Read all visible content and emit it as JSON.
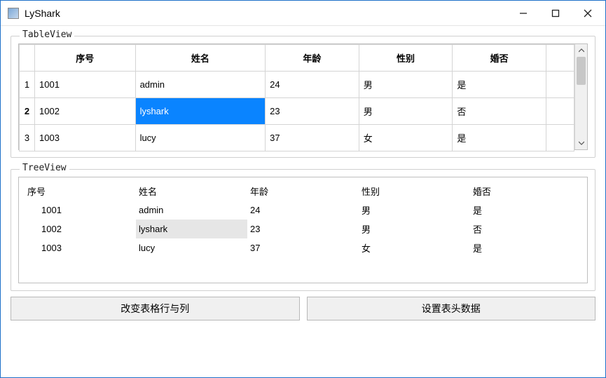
{
  "window": {
    "title": "LyShark"
  },
  "tableview": {
    "label": "TableView",
    "columns": [
      "序号",
      "姓名",
      "年龄",
      "性别",
      "婚否"
    ],
    "rowNumbers": [
      "1",
      "2",
      "3"
    ],
    "rows": [
      [
        "1001",
        "admin",
        "24",
        "男",
        "是"
      ],
      [
        "1002",
        "lyshark",
        "23",
        "男",
        "否"
      ],
      [
        "1003",
        "lucy",
        "37",
        "女",
        "是"
      ]
    ],
    "selected": {
      "row": 1,
      "col": 1
    },
    "boldRowHeader": 1
  },
  "treeview": {
    "label": "TreeView",
    "columns": [
      "序号",
      "姓名",
      "年龄",
      "性别",
      "婚否"
    ],
    "rows": [
      [
        "1001",
        "admin",
        "24",
        "男",
        "是"
      ],
      [
        "1002",
        "lyshark",
        "23",
        "男",
        "否"
      ],
      [
        "1003",
        "lucy",
        "37",
        "女",
        "是"
      ]
    ],
    "selected": {
      "row": 1,
      "col": 1
    }
  },
  "buttons": {
    "change": "改变表格行与列",
    "header": "设置表头数据"
  }
}
